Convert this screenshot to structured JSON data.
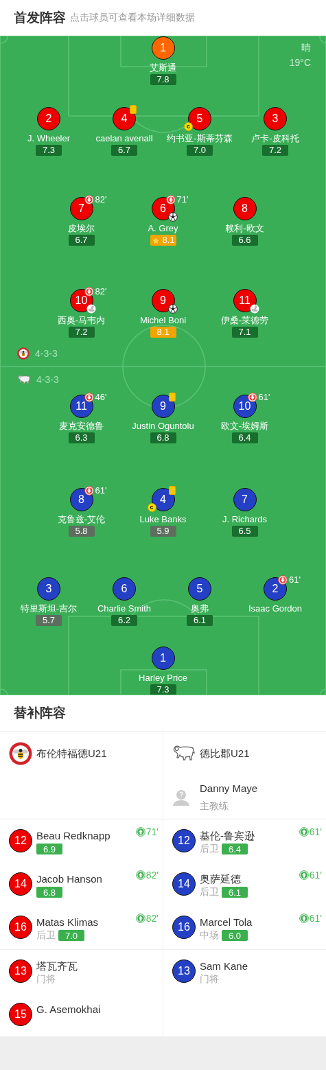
{
  "header": {
    "title": "首发阵容",
    "subtitle": "点击球员可查看本场详细数据"
  },
  "weather": {
    "condition": "晴",
    "temperature": "19°C"
  },
  "field": {
    "home": {
      "formation": "4-3-3",
      "lines": [
        [
          {
            "number": "1",
            "name": "艾斯通",
            "rating": "7.8",
            "best": false,
            "low": false,
            "mvp": false,
            "color": "#ff6600"
          }
        ],
        [
          {
            "number": "2",
            "name": "J. Wheeler",
            "rating": "7.3",
            "best": false,
            "low": false,
            "mvp": false,
            "color": "#ee0000"
          },
          {
            "number": "4",
            "name": "caelan avenall",
            "rating": "6.7",
            "best": false,
            "low": false,
            "mvp": false,
            "color": "#ee0000",
            "events": [
              {
                "kind": "yellow_card"
              }
            ]
          },
          {
            "number": "5",
            "name": "约书亚-斯蒂芬森",
            "rating": "7.0",
            "best": false,
            "low": false,
            "mvp": false,
            "color": "#ee0000",
            "events": [
              {
                "kind": "captain",
                "label": "c"
              }
            ]
          },
          {
            "number": "3",
            "name": "卢卡-皮科托",
            "rating": "7.2",
            "best": false,
            "low": false,
            "mvp": false,
            "color": "#ee0000"
          }
        ],
        [
          {
            "number": "7",
            "name": "皮埃尔",
            "rating": "6.7",
            "best": false,
            "low": false,
            "mvp": false,
            "color": "#ee0000",
            "events": [
              {
                "kind": "sub_off",
                "minute": "82'"
              }
            ]
          },
          {
            "number": "6",
            "name": "A. Grey",
            "rating": "8.1",
            "best": true,
            "low": false,
            "mvp": true,
            "color": "#ee0000",
            "events": [
              {
                "kind": "sub_off",
                "minute": "71'"
              },
              {
                "kind": "goal"
              }
            ]
          },
          {
            "number": "8",
            "name": "赖利-欧文",
            "rating": "6.6",
            "best": false,
            "low": false,
            "mvp": false,
            "color": "#ee0000"
          }
        ],
        [
          {
            "number": "10",
            "name": "西奥-马韦内",
            "rating": "7.2",
            "best": false,
            "low": false,
            "mvp": false,
            "color": "#ee0000",
            "events": [
              {
                "kind": "sub_off",
                "minute": "82'"
              },
              {
                "kind": "assist"
              }
            ]
          },
          {
            "number": "9",
            "name": "Michel Boni",
            "rating": "8.1",
            "best": true,
            "low": false,
            "mvp": false,
            "color": "#ee0000",
            "events": [
              {
                "kind": "goal"
              }
            ]
          },
          {
            "number": "11",
            "name": "伊桑-莱德劳",
            "rating": "7.1",
            "best": false,
            "low": false,
            "mvp": false,
            "color": "#ee0000",
            "events": [
              {
                "kind": "assist"
              }
            ]
          }
        ]
      ]
    },
    "away": {
      "formation": "4-3-3",
      "lines": [
        [
          {
            "number": "11",
            "name": "麦克安德鲁",
            "rating": "6.3",
            "best": false,
            "low": false,
            "mvp": false,
            "color": "#2440c4",
            "events": [
              {
                "kind": "sub_off",
                "minute": "46'"
              }
            ]
          },
          {
            "number": "9",
            "name": "Justin Oguntolu",
            "rating": "6.8",
            "best": false,
            "low": false,
            "mvp": false,
            "color": "#2440c4",
            "events": [
              {
                "kind": "yellow_card"
              }
            ]
          },
          {
            "number": "10",
            "name": "欧文-埃姆斯",
            "rating": "6.4",
            "best": false,
            "low": false,
            "mvp": false,
            "color": "#2440c4",
            "events": [
              {
                "kind": "sub_off",
                "minute": "61'"
              }
            ]
          }
        ],
        [
          {
            "number": "8",
            "name": "克鲁兹-艾伦",
            "rating": "5.8",
            "best": false,
            "low": true,
            "mvp": false,
            "color": "#2440c4",
            "events": [
              {
                "kind": "sub_off",
                "minute": "61'"
              }
            ]
          },
          {
            "number": "4",
            "name": "Luke Banks",
            "rating": "5.9",
            "best": false,
            "low": true,
            "mvp": false,
            "color": "#2440c4",
            "events": [
              {
                "kind": "yellow_card"
              },
              {
                "kind": "captain",
                "label": "c"
              }
            ]
          },
          {
            "number": "7",
            "name": "J. Richards",
            "rating": "6.5",
            "best": false,
            "low": false,
            "mvp": false,
            "color": "#2440c4"
          }
        ],
        [
          {
            "number": "3",
            "name": "特里斯坦-吉尔",
            "rating": "5.7",
            "best": false,
            "low": true,
            "mvp": false,
            "color": "#2440c4"
          },
          {
            "number": "6",
            "name": "Charlie Smith",
            "rating": "6.2",
            "best": false,
            "low": false,
            "mvp": false,
            "color": "#2440c4"
          },
          {
            "number": "5",
            "name": "奥弗",
            "rating": "6.1",
            "best": false,
            "low": false,
            "mvp": false,
            "color": "#2440c4"
          },
          {
            "number": "2",
            "name": "Isaac Gordon",
            "color": "#2440c4",
            "events": [
              {
                "kind": "sub_off",
                "minute": "61'"
              }
            ]
          }
        ],
        [
          {
            "number": "1",
            "name": "Harley Price",
            "rating": "7.3",
            "best": false,
            "low": false,
            "mvp": false,
            "color": "#2440c4"
          }
        ]
      ]
    }
  },
  "substitutes": {
    "title": "替补阵容",
    "teams": [
      {
        "name": "布伦特福德U21",
        "used": [
          {
            "number": "12",
            "name": "Beau Redknapp",
            "rating": "6.9",
            "minute": "71'",
            "color": "#ee0000"
          },
          {
            "number": "14",
            "name": "Jacob Hanson",
            "rating": "6.8",
            "minute": "82'",
            "color": "#ee0000"
          },
          {
            "number": "16",
            "name": "Matas Klimas",
            "position": "后卫",
            "rating": "7.0",
            "minute": "82'",
            "color": "#ee0000"
          }
        ],
        "unused": [
          {
            "number": "13",
            "name": "塔瓦齐瓦",
            "position": "门将",
            "color": "#ee0000"
          },
          {
            "number": "15",
            "name": "G. Asemokhai",
            "color": "#ee0000"
          }
        ]
      },
      {
        "name": "德比郡U21",
        "coach": {
          "name": "Danny Maye",
          "role": "主教练"
        },
        "used": [
          {
            "number": "12",
            "name": "基伦-鲁宾逊",
            "position": "后卫",
            "rating": "6.4",
            "minute": "61'",
            "color": "#2440c4"
          },
          {
            "number": "14",
            "name": "奥萨延德",
            "position": "后卫",
            "rating": "6.1",
            "minute": "61'",
            "color": "#2440c4"
          },
          {
            "number": "16",
            "name": "Marcel Tola",
            "position": "中场",
            "rating": "6.0",
            "minute": "61'",
            "color": "#2440c4"
          }
        ],
        "unused": [
          {
            "number": "13",
            "name": "Sam Kane",
            "position": "门将",
            "color": "#2440c4"
          }
        ]
      }
    ]
  }
}
